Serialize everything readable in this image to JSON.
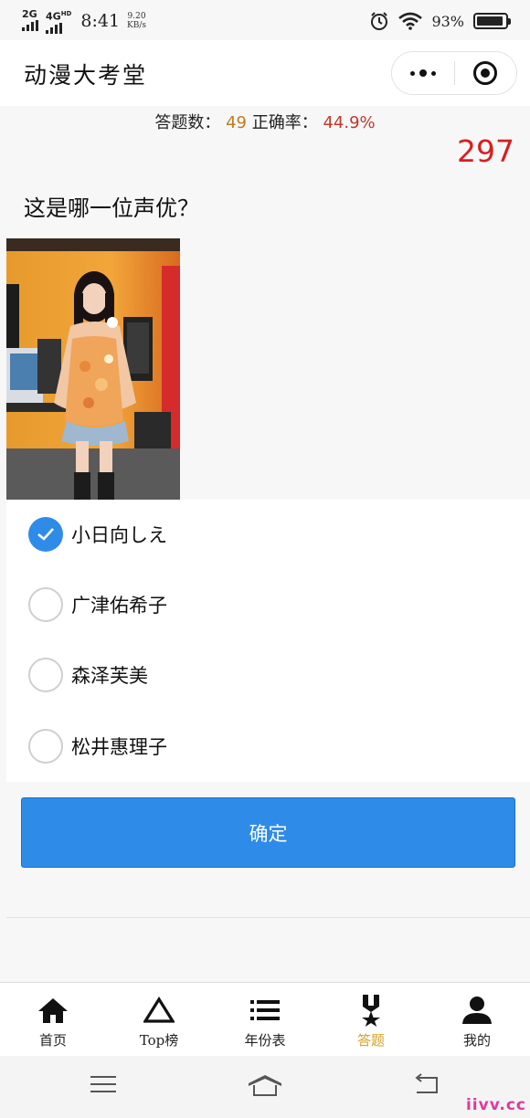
{
  "status_bar": {
    "network1": "2G",
    "network2": "4G",
    "network2_sup": "HD",
    "time": "8:41",
    "speed_value": "9.20",
    "speed_unit": "KB/s",
    "battery": "93%",
    "battery_level": 0.93
  },
  "header": {
    "title": "动漫大考堂",
    "menu_icon": "more-dots-icon",
    "close_icon": "target-circle-icon"
  },
  "stats": {
    "answered_label": "答题数：",
    "answered_value": "49",
    "accuracy_label": "正确率：",
    "accuracy_value": "44.9%"
  },
  "score": "297",
  "question": "这是哪一位声优？",
  "options": [
    {
      "label": "小日向しえ",
      "checked": true
    },
    {
      "label": "广津佑希子",
      "checked": false
    },
    {
      "label": "森泽芙美",
      "checked": false
    },
    {
      "label": "松井惠理子",
      "checked": false
    }
  ],
  "confirm_label": "确定",
  "tabs": [
    {
      "label": "首页",
      "icon": "home-icon",
      "active": false
    },
    {
      "label": "Top榜",
      "icon": "triangle-icon",
      "active": false
    },
    {
      "label": "年份表",
      "icon": "list-icon",
      "active": false
    },
    {
      "label": "答题",
      "icon": "medal-icon",
      "active": true
    },
    {
      "label": "我的",
      "icon": "user-icon",
      "active": false
    }
  ],
  "colors": {
    "accent": "#2f8be8",
    "active_tab": "#d9a12a",
    "score": "#d81e1e",
    "count": "#c07b1e",
    "rate": "#c0392b"
  },
  "watermark": "iivv.cc"
}
